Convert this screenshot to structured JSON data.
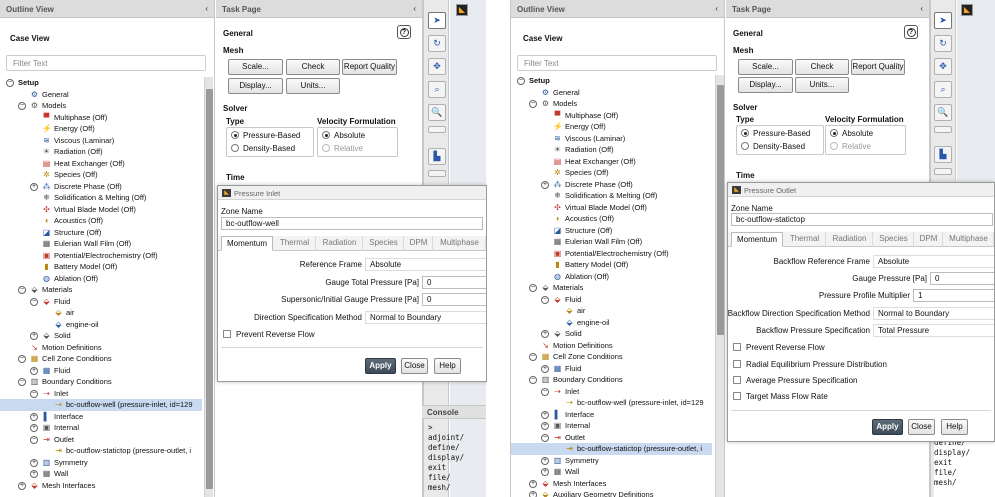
{
  "colors": {
    "accent": "#4a5866",
    "selection": "#c9d9ef",
    "header": "#dcdcdc"
  },
  "left": {
    "outline": {
      "title": "Outline View",
      "case_view": "Case View",
      "filter_placeholder": "Filter Text",
      "tree": [
        {
          "label": "Setup",
          "bold": true,
          "icon": "collapse-icon"
        },
        {
          "label": "General",
          "icon": "general-icon"
        },
        {
          "label": "Models",
          "icon": "models-icon"
        },
        {
          "label": "Multiphase (Off)",
          "icon": "multiphase-icon"
        },
        {
          "label": "Energy (Off)",
          "icon": "energy-icon"
        },
        {
          "label": "Viscous (Laminar)",
          "icon": "viscous-icon"
        },
        {
          "label": "Radiation (Off)",
          "icon": "radiation-icon"
        },
        {
          "label": "Heat Exchanger (Off)",
          "icon": "heat-exchanger-icon"
        },
        {
          "label": "Species (Off)",
          "icon": "species-icon"
        },
        {
          "label": "Discrete Phase (Off)",
          "icon": "discrete-phase-icon"
        },
        {
          "label": "Solidification & Melting (Off)",
          "icon": "solidification-icon"
        },
        {
          "label": "Virtual Blade Model (Off)",
          "icon": "blade-icon"
        },
        {
          "label": "Acoustics (Off)",
          "icon": "acoustics-icon"
        },
        {
          "label": "Structure (Off)",
          "icon": "structure-icon"
        },
        {
          "label": "Eulerian Wall Film (Off)",
          "icon": "wall-film-icon"
        },
        {
          "label": "Potential/Electrochemistry (Off)",
          "icon": "electrochemistry-icon"
        },
        {
          "label": "Battery Model (Off)",
          "icon": "battery-icon"
        },
        {
          "label": "Ablation (Off)",
          "icon": "ablation-icon"
        },
        {
          "label": "Materials",
          "icon": "materials-icon"
        },
        {
          "label": "Fluid",
          "icon": "fluid-material-icon"
        },
        {
          "label": "air",
          "icon": "material-icon"
        },
        {
          "label": "engine-oil",
          "icon": "material-icon"
        },
        {
          "label": "Solid",
          "icon": "solid-material-icon"
        },
        {
          "label": "Motion Definitions",
          "icon": "motion-icon"
        },
        {
          "label": "Cell Zone Conditions",
          "icon": "cell-zone-icon"
        },
        {
          "label": "Fluid",
          "icon": "fluid-zone-icon"
        },
        {
          "label": "Boundary Conditions",
          "icon": "boundary-icon"
        },
        {
          "label": "Inlet",
          "icon": "inlet-icon"
        },
        {
          "label": "bc-outflow-well (pressure-inlet, id=129",
          "icon": "inlet-bc-icon",
          "selected": true
        },
        {
          "label": "Interface",
          "icon": "interface-icon"
        },
        {
          "label": "Internal",
          "icon": "internal-icon"
        },
        {
          "label": "Outlet",
          "icon": "outlet-icon"
        },
        {
          "label": "bc-outflow-statictop (pressure-outlet, i",
          "icon": "outlet-bc-icon"
        },
        {
          "label": "Symmetry",
          "icon": "symmetry-icon"
        },
        {
          "label": "Wall",
          "icon": "wall-icon"
        },
        {
          "label": "Mesh Interfaces",
          "icon": "mesh-interfaces-icon"
        }
      ]
    },
    "task": {
      "title": "Task Page",
      "heading": "General",
      "mesh_label": "Mesh",
      "buttons": [
        "Scale...",
        "Check",
        "Report Quality",
        "Display...",
        "Units..."
      ],
      "solver_label": "Solver",
      "type_label": "Type",
      "pressure_based": "Pressure-Based",
      "density_based": "Density-Based",
      "velocity_label": "Velocity Formulation",
      "absolute": "Absolute",
      "relative": "Relative",
      "time_label": "Time"
    },
    "console": {
      "title": "Console",
      "lines": [
        ">",
        "adjoint/",
        "define/",
        "display/",
        "exit",
        "file/",
        "mesh/"
      ]
    },
    "dialog": {
      "title": "Pressure Inlet",
      "zone_name_label": "Zone Name",
      "zone_name": "bc-outflow-well",
      "tabs": [
        "Momentum",
        "Thermal",
        "Radiation",
        "Species",
        "DPM",
        "Multiphase"
      ],
      "fields": [
        {
          "label": "Reference Frame",
          "value": "Absolute"
        },
        {
          "label": "Gauge Total Pressure [Pa]",
          "value": "0"
        },
        {
          "label": "Supersonic/Initial Gauge Pressure [Pa]",
          "value": "0"
        },
        {
          "label": "Direction Specification Method",
          "value": "Normal to Boundary"
        }
      ],
      "checks": [
        "Prevent Reverse Flow"
      ],
      "apply": "Apply",
      "close": "Close",
      "help": "Help"
    }
  },
  "right": {
    "outline": {
      "title": "Outline View",
      "case_view": "Case View",
      "filter_placeholder": "Filter Text",
      "tree": [
        {
          "label": "Setup",
          "bold": true
        },
        {
          "label": "General"
        },
        {
          "label": "Models"
        },
        {
          "label": "Multiphase (Off)"
        },
        {
          "label": "Energy (Off)"
        },
        {
          "label": "Viscous (Laminar)"
        },
        {
          "label": "Radiation (Off)"
        },
        {
          "label": "Heat Exchanger (Off)"
        },
        {
          "label": "Species (Off)"
        },
        {
          "label": "Discrete Phase (Off)"
        },
        {
          "label": "Solidification & Melting (Off)"
        },
        {
          "label": "Virtual Blade Model (Off)"
        },
        {
          "label": "Acoustics (Off)"
        },
        {
          "label": "Structure (Off)"
        },
        {
          "label": "Eulerian Wall Film (Off)"
        },
        {
          "label": "Potential/Electrochemistry (Off)"
        },
        {
          "label": "Battery Model (Off)"
        },
        {
          "label": "Ablation (Off)"
        },
        {
          "label": "Materials"
        },
        {
          "label": "Fluid"
        },
        {
          "label": "air"
        },
        {
          "label": "engine-oil"
        },
        {
          "label": "Solid"
        },
        {
          "label": "Motion Definitions"
        },
        {
          "label": "Cell Zone Conditions"
        },
        {
          "label": "Fluid"
        },
        {
          "label": "Boundary Conditions"
        },
        {
          "label": "Inlet"
        },
        {
          "label": "bc-outflow-well (pressure-inlet, id=129"
        },
        {
          "label": "Interface"
        },
        {
          "label": "Internal"
        },
        {
          "label": "Outlet"
        },
        {
          "label": "bc-outflow-statictop (pressure-outlet, i",
          "selected": true
        },
        {
          "label": "Symmetry"
        },
        {
          "label": "Wall"
        },
        {
          "label": "Mesh Interfaces"
        },
        {
          "label": "Auxiliary Geometry Definitions"
        }
      ]
    },
    "task": {
      "title": "Task Page",
      "heading": "General",
      "mesh_label": "Mesh",
      "buttons": [
        "Scale...",
        "Check",
        "Report Quality",
        "Display...",
        "Units..."
      ],
      "solver_label": "Solver",
      "type_label": "Type",
      "pressure_based": "Pressure-Based",
      "density_based": "Density-Based",
      "velocity_label": "Velocity Formulation",
      "absolute": "Absolute",
      "relative": "Relative",
      "time_label": "Time"
    },
    "console": {
      "lines": [
        "define/",
        "display/",
        "exit",
        "file/",
        "mesh/"
      ]
    },
    "dialog": {
      "title": "Pressure Outlet",
      "zone_name_label": "Zone Name",
      "zone_name": "bc-outflow-statictop",
      "tabs": [
        "Momentum",
        "Thermal",
        "Radiation",
        "Species",
        "DPM",
        "Multiphase"
      ],
      "fields": [
        {
          "label": "Backflow Reference Frame",
          "value": "Absolute"
        },
        {
          "label": "Gauge Pressure [Pa]",
          "value": "0"
        },
        {
          "label": "Pressure Profile Multiplier",
          "value": "1"
        },
        {
          "label": "Backflow Direction Specification Method",
          "value": "Normal to Boundary"
        },
        {
          "label": "Backflow Pressure Specification",
          "value": "Total Pressure"
        }
      ],
      "checks": [
        "Prevent Reverse Flow",
        "Radial Equilibrium Pressure Distribution",
        "Average Pressure Specification",
        "Target Mass Flow Rate"
      ],
      "apply": "Apply",
      "close": "Close",
      "help": "Help"
    }
  }
}
